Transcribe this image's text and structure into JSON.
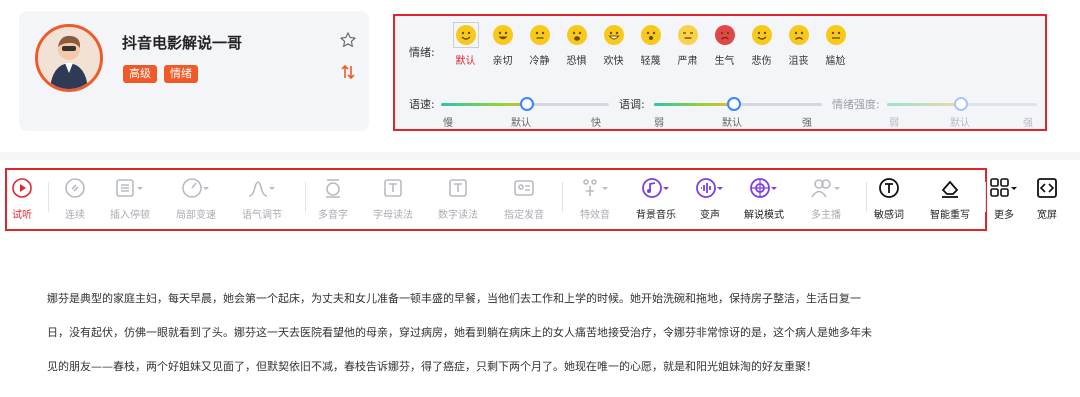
{
  "voice": {
    "name": "抖音电影解说一哥",
    "tags": [
      "高级",
      "情绪"
    ],
    "avatar_icon": "person-avatar",
    "favorite_icon": "star-outline-icon",
    "sort_icon": "sort-arrows-icon"
  },
  "emotion": {
    "label": "情绪:",
    "items": [
      "默认",
      "亲切",
      "冷静",
      "恐惧",
      "欢快",
      "轻蔑",
      "严肃",
      "生气",
      "悲伤",
      "沮丧",
      "尴尬"
    ],
    "selected": "默认"
  },
  "sliders": {
    "speed": {
      "label": "语速:",
      "marks": [
        "慢",
        "默认",
        "快"
      ],
      "value": 0.5
    },
    "pitch": {
      "label": "语调:",
      "marks": [
        "弱",
        "默认",
        "强"
      ],
      "value": 0.5
    },
    "intensity": {
      "label": "情绪强度:",
      "marks": [
        "弱",
        "默认",
        "强"
      ],
      "value": 0.5,
      "disabled": true
    }
  },
  "toolbar": {
    "items": [
      {
        "label": "试听",
        "icon": "play-circle-icon",
        "state": "active"
      },
      {
        "label": "连续",
        "icon": "continuous-icon",
        "state": "disabled"
      },
      {
        "label": "插入停顿",
        "icon": "pause-insert-icon",
        "state": "disabled"
      },
      {
        "label": "局部变速",
        "icon": "speed-gauge-icon",
        "state": "disabled"
      },
      {
        "label": "语气调节",
        "icon": "tone-curve-icon",
        "state": "disabled"
      },
      {
        "label": "多音字",
        "icon": "polyphone-icon",
        "state": "disabled"
      },
      {
        "label": "字母读法",
        "icon": "letter-reading-icon",
        "state": "disabled"
      },
      {
        "label": "数字读法",
        "icon": "number-reading-icon",
        "state": "disabled"
      },
      {
        "label": "指定发音",
        "icon": "pronunciation-icon",
        "state": "disabled"
      },
      {
        "label": "特效音",
        "icon": "sound-effect-icon",
        "state": "disabled"
      },
      {
        "label": "背景音乐",
        "icon": "background-music-icon",
        "state": "enabled"
      },
      {
        "label": "变声",
        "icon": "voice-change-icon",
        "state": "enabled"
      },
      {
        "label": "解说模式",
        "icon": "narration-mode-icon",
        "state": "enabled"
      },
      {
        "label": "多主播",
        "icon": "multi-anchor-icon",
        "state": "disabled"
      },
      {
        "label": "敏感词",
        "icon": "sensitive-word-icon",
        "state": "enabled"
      },
      {
        "label": "智能重写",
        "icon": "smart-rewrite-icon",
        "state": "enabled"
      },
      {
        "label": "更多",
        "icon": "more-grid-icon",
        "state": "enabled"
      },
      {
        "label": "宽屏",
        "icon": "widescreen-icon",
        "state": "enabled"
      }
    ]
  },
  "article": {
    "lines": [
      "娜芬是典型的家庭主妇，每天早晨，她会第一个起床，为丈夫和女儿准备一顿丰盛的早餐，当他们去工作和上学的时候。她开始洗碗和拖地，保持房子整洁，生活日复一",
      "日，没有起伏，仿佛一眼就看到了头。娜芬这一天去医院看望他的母亲，穿过病房，她看到躺在病床上的女人痛苦地接受治疗，令娜芬非常惊讶的是，这个病人是她多年未",
      "见的朋友——春枝，两个好姐妹又见面了，但默契依旧不减，春枝告诉娜芬，得了癌症，只剩下两个月了。她现在唯一的心愿，就是和阳光姐妹淘的好友重聚！"
    ]
  },
  "colors": {
    "accent_red": "#e0262d",
    "tag_orange": "#f05a28",
    "emoji_yellow": "#f7c91b",
    "slider_blue": "#3a86ff"
  }
}
